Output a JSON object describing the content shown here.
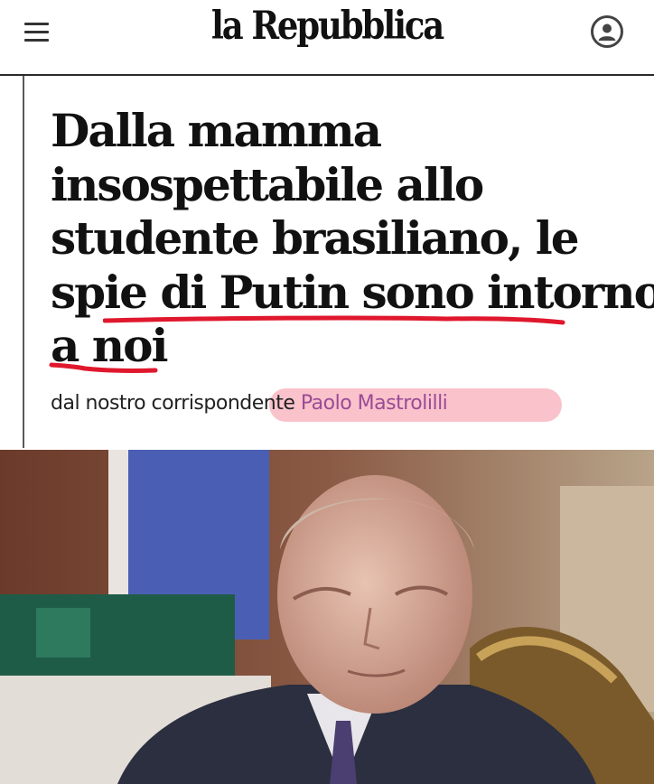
{
  "header": {
    "logo": "la Repubblica",
    "menu_icon": "hamburger-menu-icon",
    "user_icon": "user-account-icon"
  },
  "article": {
    "headline_lines": [
      "Dalla mamma",
      "insospettabile allo",
      "studente brasiliano, le",
      "spie di Putin sono intorno",
      "a noi"
    ],
    "byline_prefix": "dal nostro corrispondente",
    "author": "Paolo Mastrolilli"
  },
  "annotations": {
    "underline_color": "#e0182d",
    "highlight_color": "#f4788c"
  },
  "photo": {
    "description_icon": "article-photo"
  }
}
